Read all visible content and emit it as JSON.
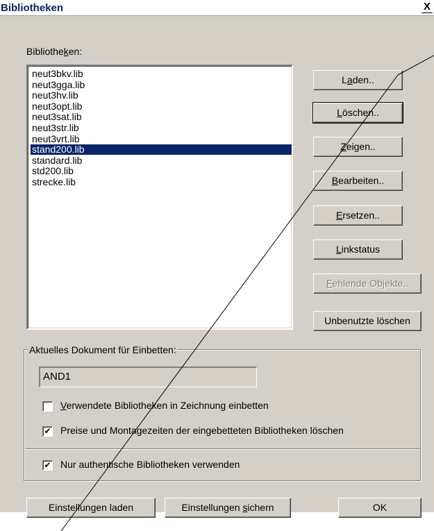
{
  "window": {
    "title": "Bibliotheken",
    "close_glyph": "X"
  },
  "libraries": {
    "label_pre": "Bibliothe",
    "label_key": "k",
    "label_post": "en:",
    "items": [
      {
        "name": "neut3bkv.lib",
        "selected": false
      },
      {
        "name": "neut3gga.lib",
        "selected": false
      },
      {
        "name": "neut3hv.lib",
        "selected": false
      },
      {
        "name": "neut3opt.lib",
        "selected": false
      },
      {
        "name": "neut3sat.lib",
        "selected": false
      },
      {
        "name": "neut3str.lib",
        "selected": false
      },
      {
        "name": "neut3vrt.lib",
        "selected": false
      },
      {
        "name": "stand200.lib",
        "selected": true
      },
      {
        "name": "standard.lib",
        "selected": false
      },
      {
        "name": "std200.lib",
        "selected": false
      },
      {
        "name": "strecke.lib",
        "selected": false
      }
    ]
  },
  "buttons": {
    "laden": {
      "pre": "L",
      "key": "a",
      "post": "den.."
    },
    "loeschen": {
      "pre": "",
      "key": "L",
      "post": "öschen.."
    },
    "zeigen": {
      "pre": "",
      "key": "Z",
      "post": "eigen.."
    },
    "bearbeiten": {
      "pre": "",
      "key": "B",
      "post": "earbeiten.."
    },
    "ersetzen": {
      "pre": "",
      "key": "E",
      "post": "rsetzen.."
    },
    "linkstatus": {
      "pre": "",
      "key": "L",
      "post": "inkstatus"
    },
    "fehlende": {
      "pre": "",
      "key": "F",
      "post": "ehlende Objekte.."
    },
    "unbenutzte": {
      "pre": "Unbenutzte löschen",
      "key": "",
      "post": ""
    },
    "einst_laden": {
      "pre": "Einstellungen laden",
      "key": "",
      "post": ""
    },
    "einst_sichern": {
      "pre": "Einstellungen ",
      "key": "s",
      "post": "ichern"
    },
    "ok": {
      "pre": "OK",
      "key": "",
      "post": ""
    }
  },
  "embed": {
    "legend": "Aktuelles Dokument für Einbetten:",
    "document_value": "AND1",
    "option1": {
      "pre": "",
      "key": "V",
      "post": "erwendete Bibliotheken in Zeichnung einbetten",
      "checked": false
    },
    "option2": {
      "pre": "",
      "key": "",
      "post": "Preise und Montagezeiten der eingebetteten Bibliotheken löschen",
      "checked": true
    },
    "option3": {
      "pre": "",
      "key": "",
      "post": "Nur authentische Bibliotheken verwenden",
      "checked": true
    }
  },
  "checkmark_glyph": "✔"
}
